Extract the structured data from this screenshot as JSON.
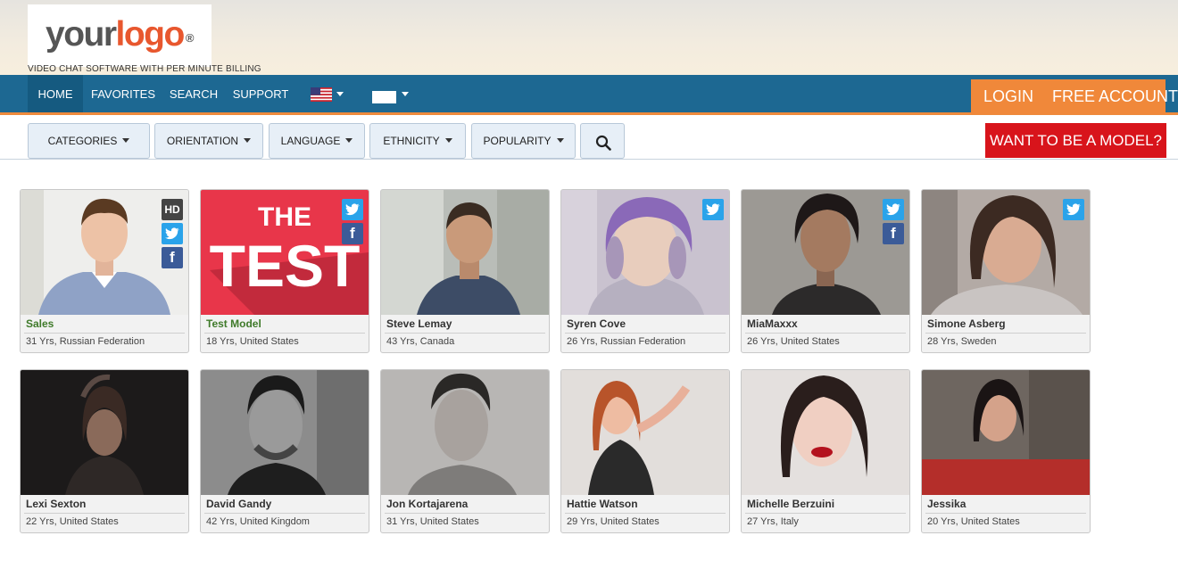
{
  "header": {
    "logo_your": "your",
    "logo_logo": "logo",
    "logo_reg": "®",
    "tagline": "VIDEO CHAT SOFTWARE WITH PER MINUTE BILLING"
  },
  "nav": {
    "home": "HOME",
    "favorites": "FAVORITES",
    "search": "SEARCH",
    "support": "SUPPORT",
    "login": "LOGIN",
    "free_account": "FREE ACCOUNT"
  },
  "filters": {
    "categories": "CATEGORIES",
    "orientation": "ORIENTATION",
    "language": "LANGUAGE",
    "ethnicity": "ETHNICITY",
    "popularity": "POPULARITY",
    "model_cta": "WANT TO BE A MODEL?"
  },
  "colors": {
    "nav_bg": "#1d6892",
    "accent_orange": "#f0883a",
    "cta_red": "#d8141b",
    "twitter": "#2aa3ea",
    "facebook": "#3b5b98",
    "name_green": "#3f7a2a"
  },
  "models": [
    {
      "name": "Sales",
      "info": "31 Yrs, Russian Federation",
      "hd": "HD",
      "twitter": true,
      "facebook": true,
      "green": true
    },
    {
      "name": "Test Model",
      "info": "18 Yrs, United States",
      "thumb_text_1": "THE",
      "thumb_text_2": "TEST",
      "twitter": true,
      "facebook": true,
      "green": true
    },
    {
      "name": "Steve Lemay",
      "info": "43 Yrs, Canada"
    },
    {
      "name": "Syren Cove",
      "info": "26 Yrs, Russian Federation",
      "twitter": true
    },
    {
      "name": "MiaMaxxx",
      "info": "26 Yrs, United States",
      "twitter": true,
      "facebook": true
    },
    {
      "name": "Simone Asberg",
      "info": "28 Yrs, Sweden",
      "twitter": true
    },
    {
      "name": "Lexi Sexton",
      "info": "22 Yrs, United States"
    },
    {
      "name": "David Gandy",
      "info": "42 Yrs, United Kingdom"
    },
    {
      "name": "Jon Kortajarena",
      "info": "31 Yrs, United States"
    },
    {
      "name": "Hattie Watson",
      "info": "29 Yrs, United States"
    },
    {
      "name": "Michelle Berzuini",
      "info": "27 Yrs, Italy"
    },
    {
      "name": "Jessika",
      "info": "20 Yrs, United States"
    }
  ]
}
